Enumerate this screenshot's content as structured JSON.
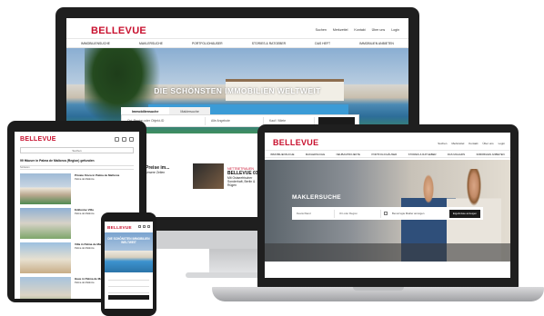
{
  "brand": {
    "name": "BELLEVUE",
    "accent": "#c8102e"
  },
  "desktop": {
    "utility_links": [
      "Suchen",
      "Merkzettel",
      "Kontakt",
      "Über uns",
      "Login"
    ],
    "nav_items": [
      "IMMOBILIENSUCHE",
      "MAKLERSUCHE",
      "PORTFOLIOHÄUSER",
      "STORIES & RATGEBER",
      "DAS HEFT",
      "IMMOBILIEN ANBIETEN"
    ],
    "hero_title": "DIE SCHÖNSTEN IMMOBILIEN WELTWEIT",
    "search_tabs": [
      "Immobiliensuche",
      "Maklersuche"
    ],
    "search_fields": [
      "Ort, Region oder Objekt-ID",
      "Alle Angebote",
      "Kauf / Miete"
    ],
    "teaser_left": {
      "head": "Preise im...",
      "sub": "Unsere Zeilen"
    },
    "teaser_right": {
      "kicker": "NETTBETRAUEN",
      "head": "BELLEVUE 03/2",
      "sub": "Mit Ostseefrischer Sonderhaft, Berlin & Rügen"
    }
  },
  "tablet": {
    "search_placeholder": "Suchen",
    "result_count": "99 Häuser in Palma de Mallorca (Region) gefunden",
    "filter_label": "Sortieren",
    "listings": [
      {
        "title": "Private Finca in Palma de Mallorca",
        "meta": "Palma de Mallorca"
      },
      {
        "title": "Exklusive Villa",
        "meta": "Palma de Mallorca"
      },
      {
        "title": "Villa in Palma de Mallorca",
        "meta": "Palma de Mallorca"
      },
      {
        "title": "Haus in Palma de Mallorca",
        "meta": "Palma de Mallorca"
      },
      {
        "title": "Luxusvilla Mallorca",
        "meta": "Palma de Mallorca"
      }
    ]
  },
  "laptop": {
    "utility_links": [
      "Suchen",
      "Merkzettel",
      "Kontakt",
      "Über uns",
      "Login"
    ],
    "nav_items": [
      "IMMOBILIENSUCHE",
      "MAKLERSUCHE",
      "NEUBAUPROJEKTE",
      "PORTFOLIOHÄUSER",
      "STORIES & RATGEBER",
      "DAS MAGAZIN",
      "IMMOBILIEN ANBIETEN"
    ],
    "hero_title": "MAKLERSUCHE",
    "search_fields": [
      "Deutschland",
      "Ort oder Region"
    ],
    "checkbox_label": "Bevorzugte Makler anzeigen",
    "search_button": "Ergebnisse anzeigen"
  },
  "phone": {
    "hero_title": "DIE SCHÖNSTEN IMMOBILIEN WELTWEIT"
  }
}
